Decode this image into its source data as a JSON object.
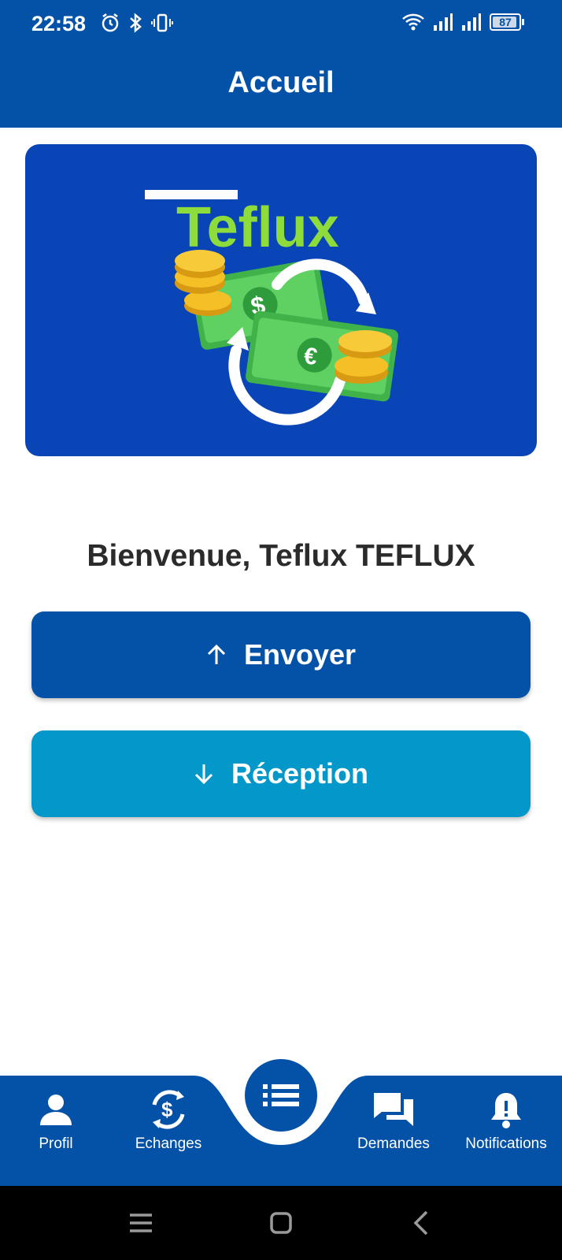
{
  "status_bar": {
    "time": "22:58",
    "battery": "87"
  },
  "app_bar": {
    "title": "Accueil"
  },
  "banner": {
    "logo_text": "Teflux"
  },
  "welcome_text": "Bienvenue, Teflux TEFLUX",
  "actions": {
    "send_label": "Envoyer",
    "receive_label": "Réception"
  },
  "bottom_nav": {
    "profil": "Profil",
    "echanges": "Echanges",
    "demandes": "Demandes",
    "notifications": "Notifications"
  },
  "colors": {
    "primary": "#0452a8",
    "secondary": "#0398c9",
    "banner_bg": "#0a45b8",
    "logo_green": "#8ddc3b"
  },
  "icons": {
    "profil": "person-icon",
    "echanges": "dollar-exchange-icon",
    "center": "list-icon",
    "demandes": "chat-icon",
    "notifications": "bell-alert-icon"
  }
}
